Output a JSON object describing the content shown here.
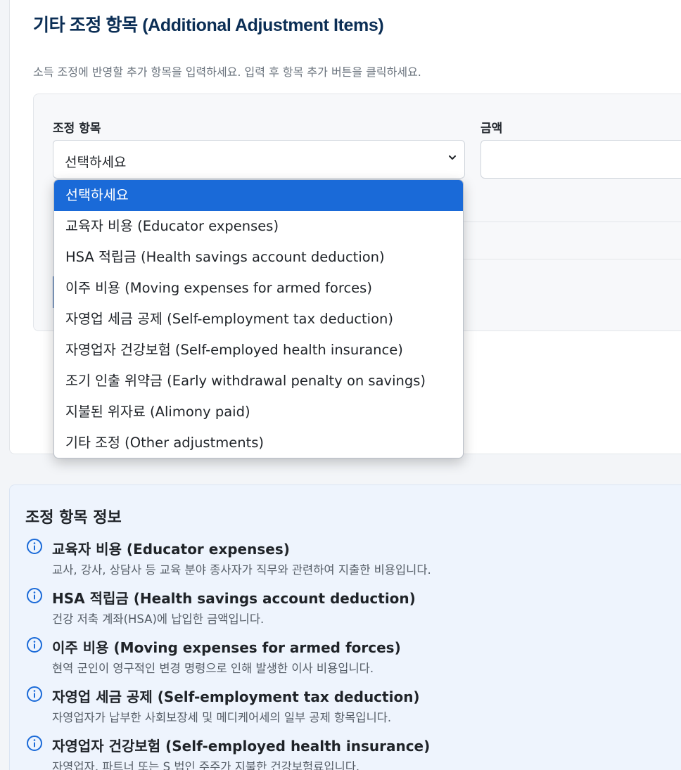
{
  "form": {
    "title": "기타 조정 항목 (Additional Adjustment Items)",
    "subtitle": "소득 조정에 반영할 추가 항목을 입력하세요. 입력 후 항목 추가 버튼을 클릭하세요.",
    "item_label": "조정 항목",
    "amount_label": "금액",
    "select_value": "선택하세요",
    "amount_value": ""
  },
  "dropdown": {
    "options": [
      "선택하세요",
      "교육자 비용 (Educator expenses)",
      "HSA 적립금 (Health savings account deduction)",
      "이주 비용 (Moving expenses for armed forces)",
      "자영업 세금 공제 (Self-employment tax deduction)",
      "자영업자 건강보험 (Self-employed health insurance)",
      "조기 인출 위약금 (Early withdrawal penalty on savings)",
      "지불된 위자료 (Alimony paid)",
      "기타 조정 (Other adjustments)"
    ],
    "selected_index": 0
  },
  "info": {
    "title": "조정 항목 정보",
    "items": [
      {
        "title": "교육자 비용 (Educator expenses)",
        "desc": "교사, 강사, 상담사 등 교육 분야 종사자가 직무와 관련하여 지출한 비용입니다."
      },
      {
        "title": "HSA 적립금 (Health savings account deduction)",
        "desc": "건강 저축 계좌(HSA)에 납입한 금액입니다."
      },
      {
        "title": "이주 비용 (Moving expenses for armed forces)",
        "desc": "현역 군인이 영구적인 변경 명령으로 인해 발생한 이사 비용입니다."
      },
      {
        "title": "자영업 세금 공제 (Self-employment tax deduction)",
        "desc": "자영업자가 납부한 사회보장세 및 메디케어세의 일부 공제 항목입니다."
      },
      {
        "title": "자영업자 건강보험 (Self-employed health insurance)",
        "desc": "자영업자, 파트너 또는 S 법인 주주가 지불한 건강보험료입니다."
      }
    ]
  },
  "colors": {
    "accent": "#1a6ad8",
    "title": "#0b2e55",
    "info_icon": "#1a6ad8"
  },
  "icons": {
    "select_arrow": "chevron-down-icon",
    "info_item": "info-circle-icon"
  }
}
